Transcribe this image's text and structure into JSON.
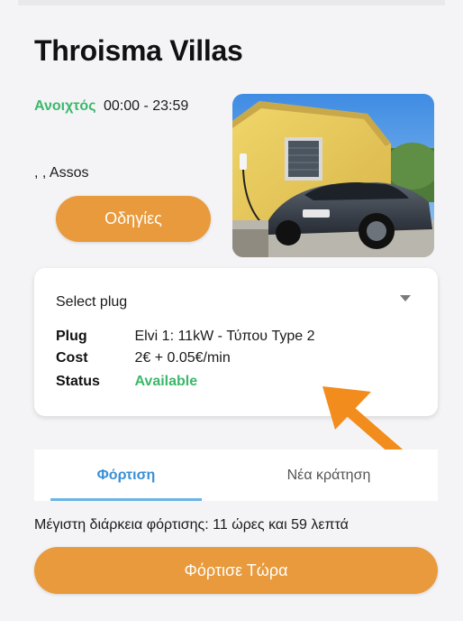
{
  "header": {
    "title": "Throisma Villas"
  },
  "location": {
    "open_status": "Ανοιχτός",
    "hours": "00:00 - 23:59",
    "address": ", , Assos",
    "directions_label": "Οδηγίες",
    "photo_icon": "charging-station-photo"
  },
  "plug_card": {
    "select_label": "Select plug",
    "rows": [
      {
        "key": "Plug",
        "value": "Elvi 1: 11kW - Τύπου Type 2"
      },
      {
        "key": "Cost",
        "value": "2€ + 0.05€/min"
      },
      {
        "key": "Status",
        "value": "Available"
      }
    ]
  },
  "tabs": [
    {
      "label": "Φόρτιση",
      "active": true
    },
    {
      "label": "Νέα κράτηση",
      "active": false
    }
  ],
  "max_duration": "Μέγιστη διάρκεια φόρτισης: 11 ώρες και 59 λεπτά",
  "charge_now_label": "Φόρτισε Τώρα",
  "colors": {
    "accent": "#e99a3c",
    "open": "#3bb86a",
    "available": "#3bb86a",
    "tab_active": "#3a8fd6",
    "annotation_arrow": "#f28c1c"
  }
}
